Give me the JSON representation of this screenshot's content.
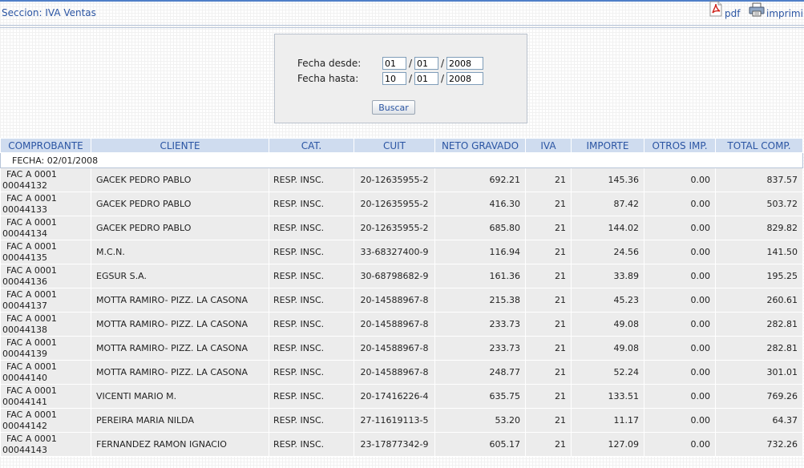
{
  "header": {
    "section_title": "Seccion: IVA Ventas",
    "pdf_label": "pdf",
    "print_label": "imprimir"
  },
  "search": {
    "from_label": "Fecha desde:",
    "to_label": "Fecha hasta:",
    "from_day": "01",
    "from_month": "01",
    "from_year": "2008",
    "to_day": "10",
    "to_month": "01",
    "to_year": "2008",
    "separator": "/",
    "button_label": "Buscar"
  },
  "table": {
    "headers": [
      "COMPROBANTE",
      "CLIENTE",
      "CAT.",
      "CUIT",
      "NETO GRAVADO",
      "IVA",
      "IMPORTE",
      "OTROS IMP.",
      "TOTAL COMP."
    ],
    "date_row": "FECHA: 02/01/2008",
    "rows": [
      {
        "comp1": "FAC A 0001",
        "comp2": "00044132",
        "cliente": "GACEK PEDRO PABLO",
        "cat": "RESP. INSC.",
        "cuit": "20-12635955-2",
        "neto": "692.21",
        "iva": "21",
        "importe": "145.36",
        "otros": "0.00",
        "total": "837.57"
      },
      {
        "comp1": "FAC A 0001",
        "comp2": "00044133",
        "cliente": "GACEK PEDRO PABLO",
        "cat": "RESP. INSC.",
        "cuit": "20-12635955-2",
        "neto": "416.30",
        "iva": "21",
        "importe": "87.42",
        "otros": "0.00",
        "total": "503.72"
      },
      {
        "comp1": "FAC A 0001",
        "comp2": "00044134",
        "cliente": "GACEK PEDRO PABLO",
        "cat": "RESP. INSC.",
        "cuit": "20-12635955-2",
        "neto": "685.80",
        "iva": "21",
        "importe": "144.02",
        "otros": "0.00",
        "total": "829.82"
      },
      {
        "comp1": "FAC A 0001",
        "comp2": "00044135",
        "cliente": "M.C.N.",
        "cat": "RESP. INSC.",
        "cuit": "33-68327400-9",
        "neto": "116.94",
        "iva": "21",
        "importe": "24.56",
        "otros": "0.00",
        "total": "141.50"
      },
      {
        "comp1": "FAC A 0001",
        "comp2": "00044136",
        "cliente": "EGSUR S.A.",
        "cat": "RESP. INSC.",
        "cuit": "30-68798682-9",
        "neto": "161.36",
        "iva": "21",
        "importe": "33.89",
        "otros": "0.00",
        "total": "195.25"
      },
      {
        "comp1": "FAC A 0001",
        "comp2": "00044137",
        "cliente": "MOTTA RAMIRO- PIZZ. LA CASONA",
        "cat": "RESP. INSC.",
        "cuit": "20-14588967-8",
        "neto": "215.38",
        "iva": "21",
        "importe": "45.23",
        "otros": "0.00",
        "total": "260.61"
      },
      {
        "comp1": "FAC A 0001",
        "comp2": "00044138",
        "cliente": "MOTTA RAMIRO- PIZZ. LA CASONA",
        "cat": "RESP. INSC.",
        "cuit": "20-14588967-8",
        "neto": "233.73",
        "iva": "21",
        "importe": "49.08",
        "otros": "0.00",
        "total": "282.81"
      },
      {
        "comp1": "FAC A 0001",
        "comp2": "00044139",
        "cliente": "MOTTA RAMIRO- PIZZ. LA CASONA",
        "cat": "RESP. INSC.",
        "cuit": "20-14588967-8",
        "neto": "233.73",
        "iva": "21",
        "importe": "49.08",
        "otros": "0.00",
        "total": "282.81"
      },
      {
        "comp1": "FAC A 0001",
        "comp2": "00044140",
        "cliente": "MOTTA RAMIRO- PIZZ. LA CASONA",
        "cat": "RESP. INSC.",
        "cuit": "20-14588967-8",
        "neto": "248.77",
        "iva": "21",
        "importe": "52.24",
        "otros": "0.00",
        "total": "301.01"
      },
      {
        "comp1": "FAC A 0001",
        "comp2": "00044141",
        "cliente": "VICENTI MARIO M.",
        "cat": "RESP. INSC.",
        "cuit": "20-17416226-4",
        "neto": "635.75",
        "iva": "21",
        "importe": "133.51",
        "otros": "0.00",
        "total": "769.26"
      },
      {
        "comp1": "FAC A 0001",
        "comp2": "00044142",
        "cliente": "PEREIRA MARIA NILDA",
        "cat": "RESP. INSC.",
        "cuit": "27-11619113-5",
        "neto": "53.20",
        "iva": "21",
        "importe": "11.17",
        "otros": "0.00",
        "total": "64.37"
      },
      {
        "comp1": "FAC A 0001",
        "comp2": "00044143",
        "cliente": "FERNANDEZ RAMON IGNACIO",
        "cat": "RESP. INSC.",
        "cuit": "23-17877342-9",
        "neto": "605.17",
        "iva": "21",
        "importe": "127.09",
        "otros": "0.00",
        "total": "732.26"
      }
    ]
  },
  "colors": {
    "accent": "#2b55a3",
    "header_bg": "#cfdcef",
    "row_bg": "#ececec",
    "top_line": "#4f7fc8"
  },
  "icons": {
    "pdf": "pdf-file-icon",
    "print": "printer-icon"
  }
}
